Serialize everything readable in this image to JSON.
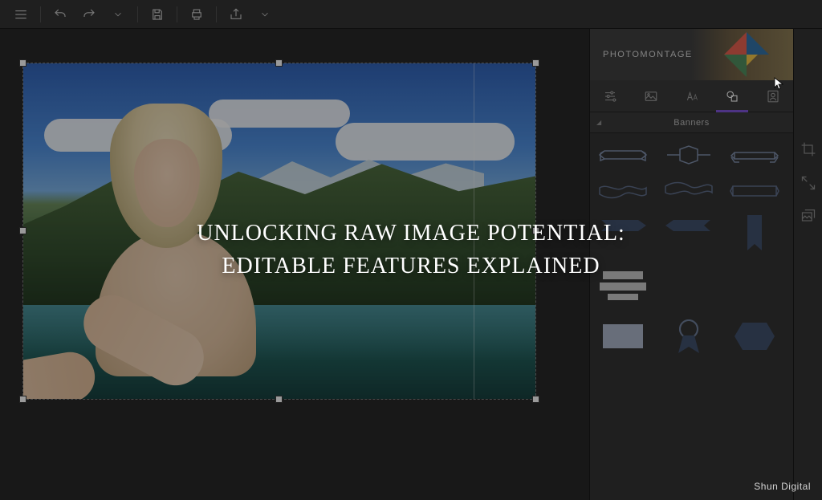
{
  "toolbar": {
    "tooltips": {
      "menu": "Menu",
      "undo": "Undo",
      "redo": "Redo",
      "save": "Save",
      "print": "Print",
      "share": "Share"
    }
  },
  "panel": {
    "title": "PHOTOMONTAGE",
    "tabs": [
      {
        "id": "adjust",
        "icon": "sliders-icon",
        "label": "Adjust"
      },
      {
        "id": "image",
        "icon": "image-icon",
        "label": "Image"
      },
      {
        "id": "text",
        "icon": "text-icon",
        "label": "Text"
      },
      {
        "id": "shapes",
        "icon": "shapes-icon",
        "label": "Shapes",
        "active": true
      },
      {
        "id": "portrait",
        "icon": "portrait-icon",
        "label": "Portrait"
      }
    ],
    "section": "Banners",
    "assets": [
      "ribbon-scroll-left",
      "ribbon-diamond",
      "ribbon-scroll-right",
      "ribbon-wave-1",
      "ribbon-wave-2",
      "ribbon-banner",
      "ribbon-arrow-left",
      "ribbon-arrow-right",
      "bookmark",
      "bars-wide",
      "placeholder",
      "placeholder",
      "rect-solid",
      "award-ribbon",
      "hexagon"
    ]
  },
  "side_tools": [
    {
      "id": "crop",
      "label": "Crop"
    },
    {
      "id": "resize",
      "label": "Resize"
    },
    {
      "id": "gallery",
      "label": "Gallery"
    }
  ],
  "overlay": {
    "line1": "UNLOCKING RAW IMAGE POTENTIAL:",
    "line2": "EDITABLE FEATURES EXPLAINED"
  },
  "watermark": "Shun Digital"
}
